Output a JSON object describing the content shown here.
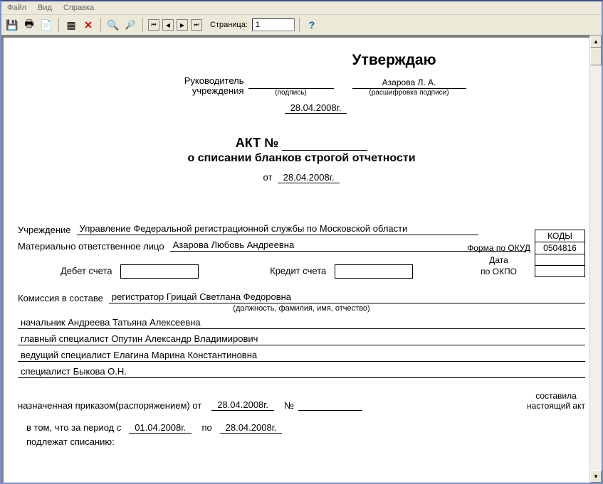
{
  "menubar": {
    "file": "Файл",
    "view": "Вид",
    "help": "Справка"
  },
  "toolbar": {
    "page_label": "Страница:",
    "page_value": "1"
  },
  "approve": {
    "title": "Утверждаю",
    "head_label_l1": "Руководитель",
    "head_label_l2": "учреждения",
    "sign_sub": "(подпись)",
    "name": "Азарова Л. А.",
    "name_sub": "(расшифровка подписи)",
    "date": "28.04.2008г."
  },
  "act": {
    "title_prefix": "АКТ №",
    "subtitle": "о списании бланков строгой отчетности",
    "ot": "от",
    "date": "28.04.2008г."
  },
  "codes": {
    "hdr": "КОДЫ",
    "okud_label": "Форма по ОКУД",
    "okud_value": "0504816",
    "date_label": "Дата",
    "date_value": "",
    "okpo_label": "по ОКПО",
    "okpo_value": ""
  },
  "org": {
    "label": "Учреждение",
    "value": "Управление Федеральной регистрационной службы по Московской области"
  },
  "mol": {
    "label": "Материально ответственное лицо",
    "value": "Азарова Любовь Андреевна"
  },
  "accounts": {
    "debit_label": "Дебет счета",
    "credit_label": "Кредит счета"
  },
  "commission": {
    "label": "Комиссия в составе",
    "head": "регистратор  Грицай Светлана Федоровна",
    "sub": "(должность, фамилия, имя, отчество)",
    "m1": "начальник  Андреева Татьяна Алексеевна",
    "m2": "главный специалист  Опутин Александр Владимирович",
    "m3": "ведущий специалист  Елагина Марина Константиновна",
    "m4": "специалист  Быкова О.Н."
  },
  "order": {
    "label": "назначенная приказом(распоряжением) от",
    "date": "28.04.2008г.",
    "num_label": "№",
    "right_l1": "составила",
    "right_l2": "настоящий акт"
  },
  "period": {
    "label_pre": "в том, что за период с",
    "from": "01.04.2008г.",
    "to_label": "по",
    "to": "28.04.2008г.",
    "bottom": "подлежат списанию:"
  }
}
